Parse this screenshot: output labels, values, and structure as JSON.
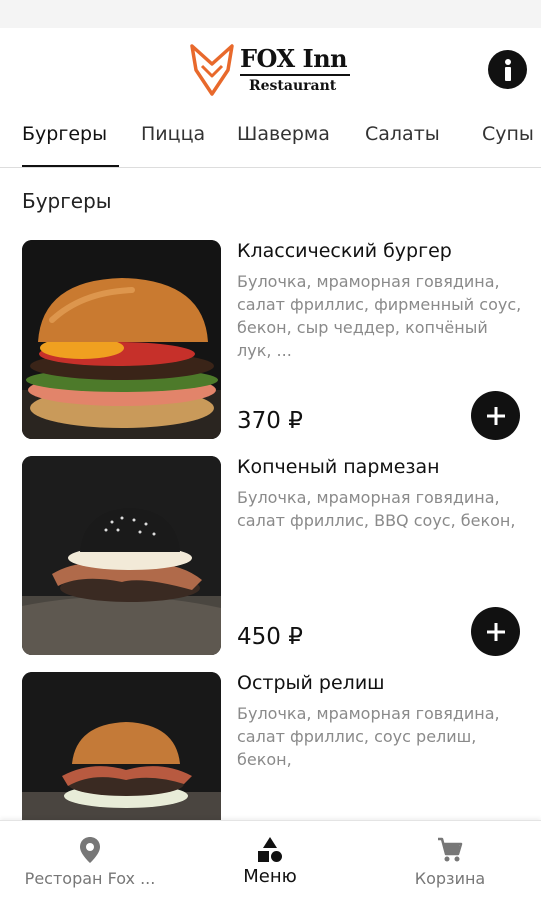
{
  "header": {
    "logo_name": "FOX Inn",
    "logo_sub": "Restaurant",
    "brand_color": "#e8692c",
    "info_icon": "info-icon"
  },
  "tabs": [
    {
      "label": "Бургеры",
      "active": true
    },
    {
      "label": "Пицца",
      "active": false
    },
    {
      "label": "Шаверма",
      "active": false
    },
    {
      "label": "Салаты",
      "active": false
    },
    {
      "label": "Супы",
      "active": false
    }
  ],
  "section_title": "Бургеры",
  "items": [
    {
      "name": "Классический бургер",
      "description": "Булочка, мраморная говядина, салат фриллис, фирменный соус, бекон, сыр чеддер, копчёный лук, ...",
      "price": "370 ₽",
      "add_icon": "plus-icon"
    },
    {
      "name": "Копченый пармезан",
      "description": "Булочка, мраморная говядина,\nсалат фриллис, BBQ соус, бекон,",
      "price": "450 ₽",
      "add_icon": "plus-icon"
    },
    {
      "name": "Острый релиш",
      "description": "Булочка, мраморная говядина,\nсалат фриллис, соус релиш, бекон,",
      "price": "",
      "add_icon": "plus-icon"
    }
  ],
  "bottom_nav": [
    {
      "label": "Ресторан Fox ...",
      "icon": "location-pin-icon",
      "active": false
    },
    {
      "label": "Меню",
      "icon": "shapes-icon",
      "active": true
    },
    {
      "label": "Корзина",
      "icon": "cart-icon",
      "active": false
    }
  ]
}
